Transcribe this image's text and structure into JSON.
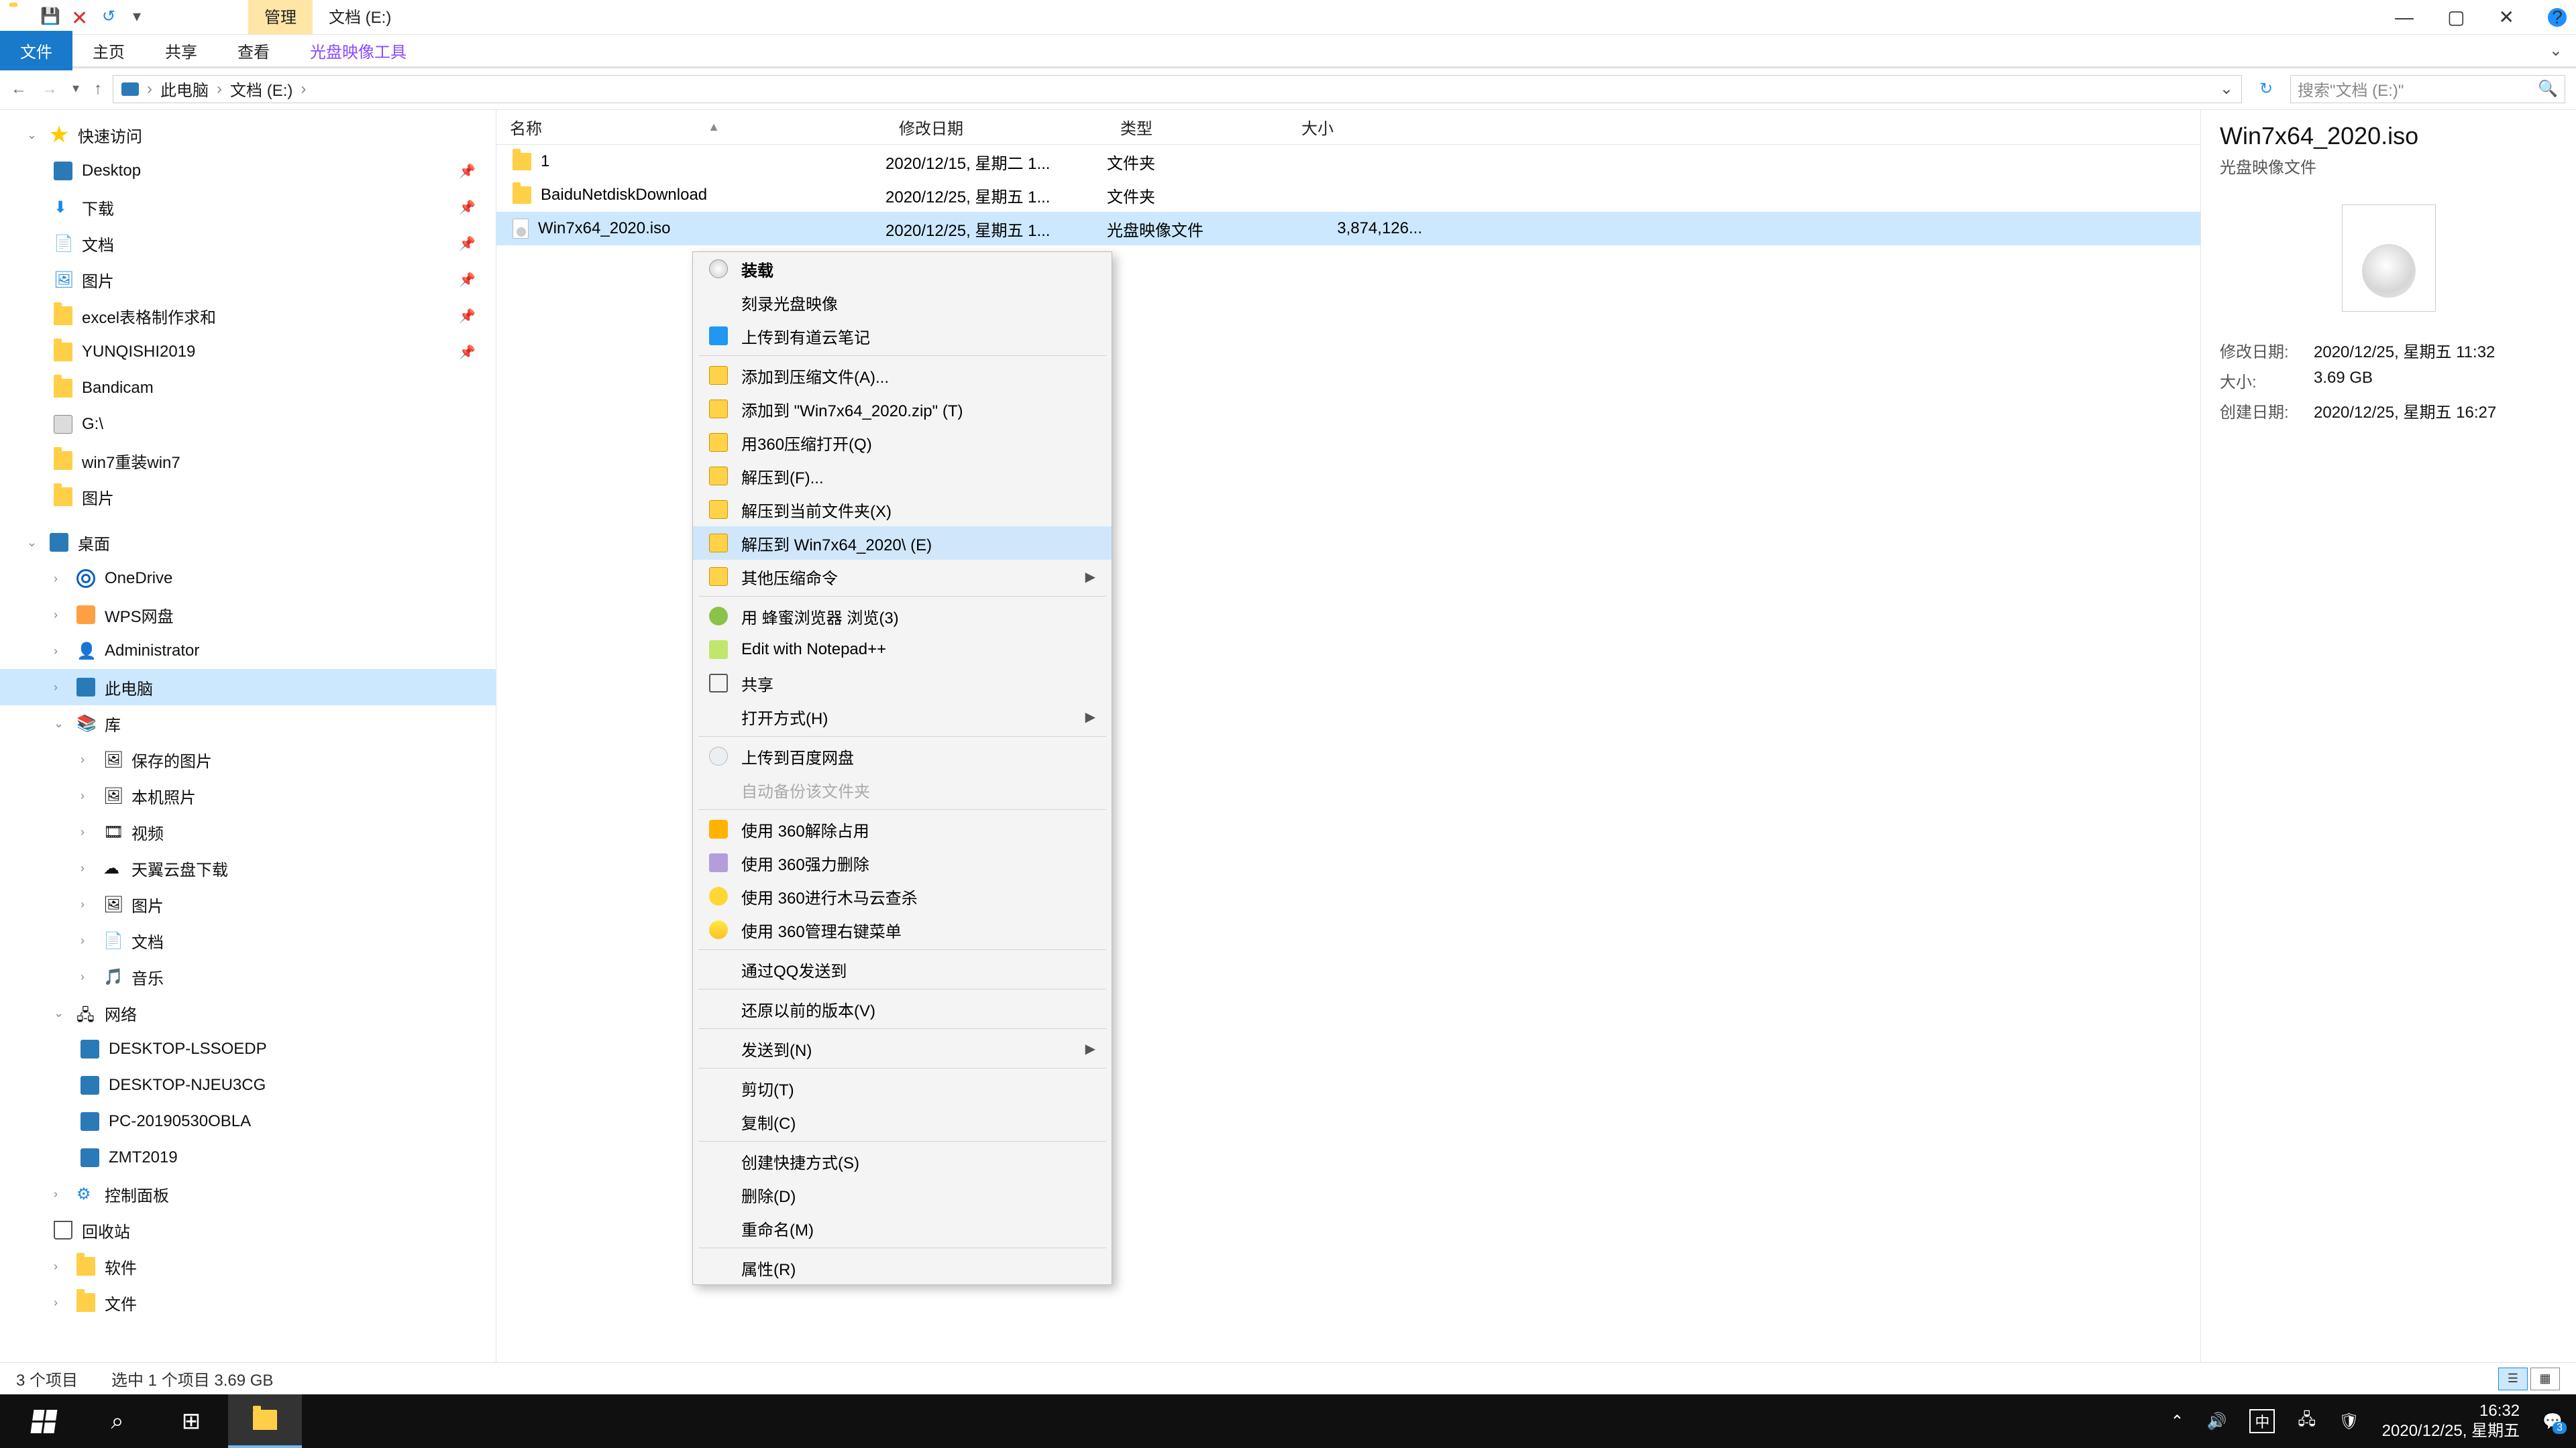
{
  "window": {
    "title_folder": "文档 (E:)",
    "tab_manage": "管理",
    "ribbon": {
      "file": "文件",
      "home": "主页",
      "share": "共享",
      "view": "查看",
      "tool": "光盘映像工具"
    }
  },
  "address": {
    "root": "此电脑",
    "folder": "文档 (E:)",
    "search_placeholder": "搜索\"文档 (E:)\""
  },
  "nav": {
    "quick": "快速访问",
    "desktop": "Desktop",
    "downloads": "下载",
    "documents": "文档",
    "pictures": "图片",
    "excel": "excel表格制作求和",
    "yunqishi": "YUNQISHI2019",
    "bandicam": "Bandicam",
    "gdrive": "G:\\",
    "win7re": "win7重装win7",
    "pictures2": "图片",
    "desktop_zh": "桌面",
    "onedrive": "OneDrive",
    "wps": "WPS网盘",
    "admin": "Administrator",
    "thispc": "此电脑",
    "libraries": "库",
    "saved_pics": "保存的图片",
    "camera_roll": "本机照片",
    "videos": "视频",
    "tianyi": "天翼云盘下载",
    "pictures3": "图片",
    "documents2": "文档",
    "music": "音乐",
    "network": "网络",
    "net1": "DESKTOP-LSSOEDP",
    "net2": "DESKTOP-NJEU3CG",
    "net3": "PC-20190530OBLA",
    "net4": "ZMT2019",
    "ctrlpanel": "控制面板",
    "recycle": "回收站",
    "software": "软件",
    "files": "文件"
  },
  "columns": {
    "name": "名称",
    "date": "修改日期",
    "type": "类型",
    "size": "大小"
  },
  "rows": [
    {
      "name": "1",
      "date": "2020/12/15, 星期二 1...",
      "type": "文件夹",
      "size": ""
    },
    {
      "name": "BaiduNetdiskDownload",
      "date": "2020/12/25, 星期五 1...",
      "type": "文件夹",
      "size": ""
    },
    {
      "name": "Win7x64_2020.iso",
      "date": "2020/12/25, 星期五 1...",
      "type": "光盘映像文件",
      "size": "3,874,126..."
    }
  ],
  "details": {
    "title": "Win7x64_2020.iso",
    "type": "光盘映像文件",
    "mod_k": "修改日期:",
    "mod_v": "2020/12/25, 星期五 11:32",
    "size_k": "大小:",
    "size_v": "3.69 GB",
    "crt_k": "创建日期:",
    "crt_v": "2020/12/25, 星期五 16:27"
  },
  "ctx": {
    "mount": "装载",
    "burn": "刻录光盘映像",
    "younote": "上传到有道云笔记",
    "add_arch": "添加到压缩文件(A)...",
    "add_zip": "添加到 \"Win7x64_2020.zip\" (T)",
    "open360": "用360压缩打开(Q)",
    "extract_to": "解压到(F)...",
    "extract_here": "解压到当前文件夹(X)",
    "extract_named": "解压到 Win7x64_2020\\ (E)",
    "other_arch": "其他压缩命令",
    "fengmi": "用 蜂蜜浏览器 浏览(3)",
    "npp": "Edit with Notepad++",
    "share": "共享",
    "open_with": "打开方式(H)",
    "baidu": "上传到百度网盘",
    "auto_backup": "自动备份该文件夹",
    "u360_unlock": "使用 360解除占用",
    "u360_force": "使用 360强力删除",
    "u360_scan": "使用 360进行木马云查杀",
    "u360_mgr": "使用 360管理右键菜单",
    "qq_send": "通过QQ发送到",
    "restore_prev": "还原以前的版本(V)",
    "send_to": "发送到(N)",
    "cut": "剪切(T)",
    "copy": "复制(C)",
    "shortcut": "创建快捷方式(S)",
    "delete": "删除(D)",
    "rename": "重命名(M)",
    "props": "属性(R)"
  },
  "status": {
    "count": "3 个项目",
    "sel": "选中 1 个项目  3.69 GB"
  },
  "tray": {
    "time": "16:32",
    "date": "2020/12/25, 星期五",
    "ime": "中"
  }
}
